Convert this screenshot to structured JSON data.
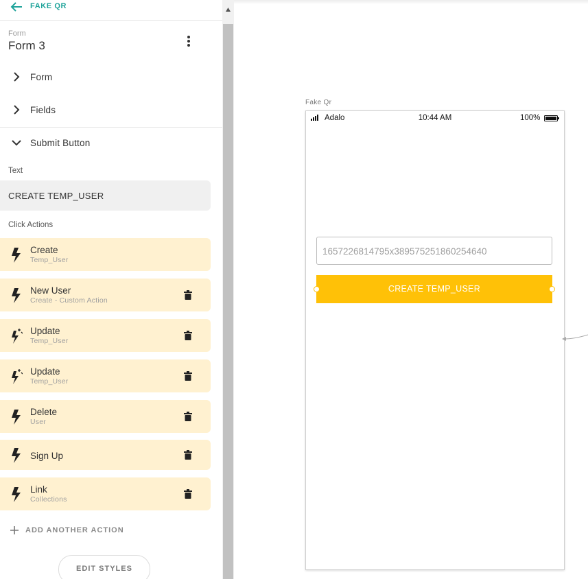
{
  "header": {
    "back_label": "FAKE QR",
    "component_type": "Form",
    "component_name": "Form 3"
  },
  "sections": [
    {
      "label": "Form",
      "expanded": false
    },
    {
      "label": "Fields",
      "expanded": false
    },
    {
      "label": "Submit Button",
      "expanded": true
    }
  ],
  "submit_button": {
    "text_heading": "Text",
    "text_value": "CREATE TEMP_USER",
    "click_actions_heading": "Click Actions",
    "actions": [
      {
        "title": "Create",
        "subtitle": "Temp_User",
        "icon": "bolt-icon"
      },
      {
        "title": "New User",
        "subtitle": "Create - Custom Action",
        "icon": "bolt-icon"
      },
      {
        "title": "Update",
        "subtitle": "Temp_User",
        "icon": "bolt-sparkle-icon"
      },
      {
        "title": "Update",
        "subtitle": "Temp_User",
        "icon": "bolt-sparkle-icon"
      },
      {
        "title": "Delete",
        "subtitle": "User",
        "icon": "bolt-icon"
      },
      {
        "title": "Sign Up",
        "subtitle": "",
        "icon": "bolt-icon"
      },
      {
        "title": "Link",
        "subtitle": "Collections",
        "icon": "bolt-icon"
      }
    ],
    "add_action_label": "ADD ANOTHER ACTION",
    "edit_styles_label": "EDIT STYLES"
  },
  "canvas": {
    "screen_label": "Fake Qr",
    "status_bar": {
      "carrier": "Adalo",
      "time": "10:44 AM",
      "battery": "100%"
    },
    "qr_input_value": "1657226814795x389575251860254640",
    "button_label": "CREATE TEMP_USER"
  },
  "colors": {
    "accent": "#1ea39a",
    "action_bg": "#fff1d0",
    "button": "#ffc107"
  }
}
